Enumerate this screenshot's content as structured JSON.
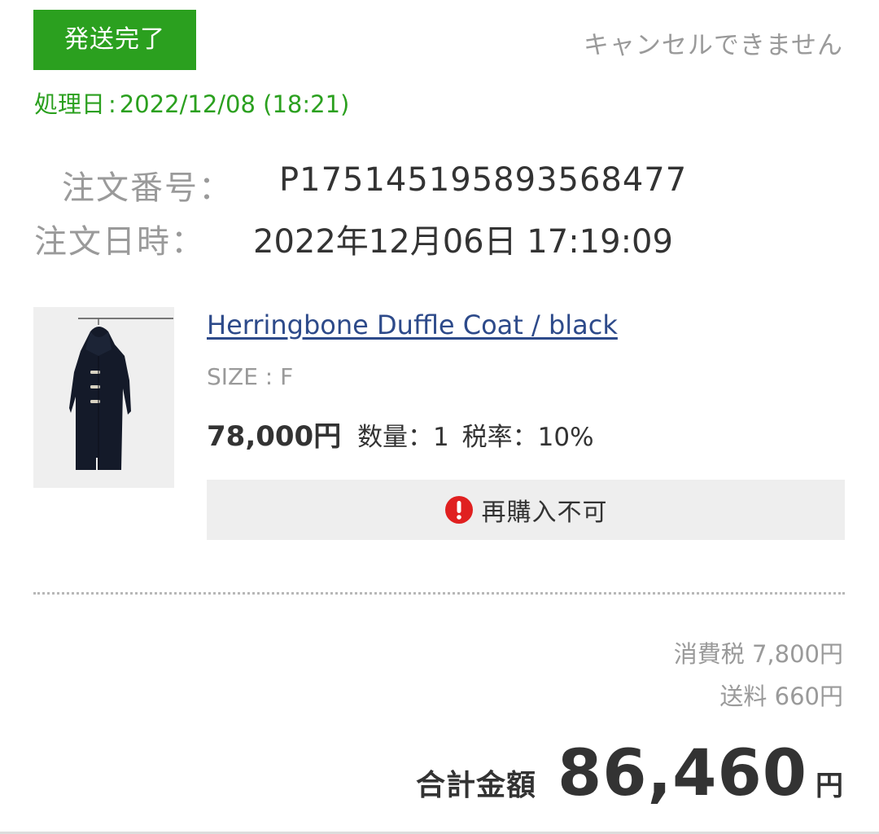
{
  "order": {
    "status_label": "発送完了",
    "cancel_note": "キャンセルできません",
    "processed_label": "処理日",
    "processed_sep": ":",
    "processed_value": "2022/12/08 (18:21)",
    "number_label": "注文番号：",
    "number_value": "P175145195893568477",
    "date_label": "注文日時：",
    "date_value": "2022年12月06日 17:19:09"
  },
  "item": {
    "image_icon": "duffle-coat-photo",
    "name": "Herringbone Duffle Coat / black",
    "size": "SIZE : F",
    "price": "78,000円",
    "quantity": "数量：1",
    "tax_rate": "税率：10%",
    "rebuy_icon": "alert-icon",
    "rebuy_text": "再購入不可"
  },
  "summary": {
    "tax": "消費税 7,800円",
    "shipping": "送料 660円",
    "total_label": "合計金額",
    "total_amount": "86,460",
    "total_unit": "円"
  },
  "colors": {
    "accent_green": "#2ba01f",
    "link_blue": "#2d4a8a",
    "alert_red": "#e02020"
  }
}
